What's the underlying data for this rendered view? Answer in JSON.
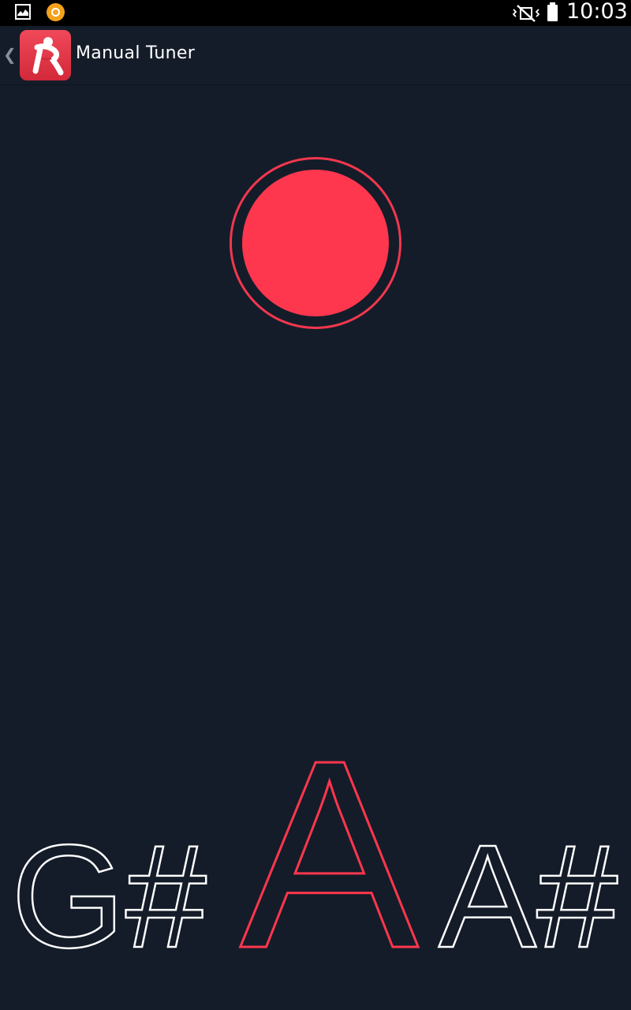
{
  "status_bar": {
    "time": "10:03",
    "icons": [
      "gallery-icon",
      "app-notification-icon",
      "vibrate-mute-icon",
      "battery-icon"
    ]
  },
  "action_bar": {
    "back_icon": "chevron-left-icon",
    "app_logo_letter": "R",
    "title": "Manual Tuner"
  },
  "tuner": {
    "record_button_icon": "record-icon",
    "notes": {
      "previous": "G#",
      "current": "A",
      "next": "A#"
    }
  },
  "colors": {
    "background": "#141c29",
    "accent": "#fe374e",
    "note_inactive": "#ffffff"
  }
}
